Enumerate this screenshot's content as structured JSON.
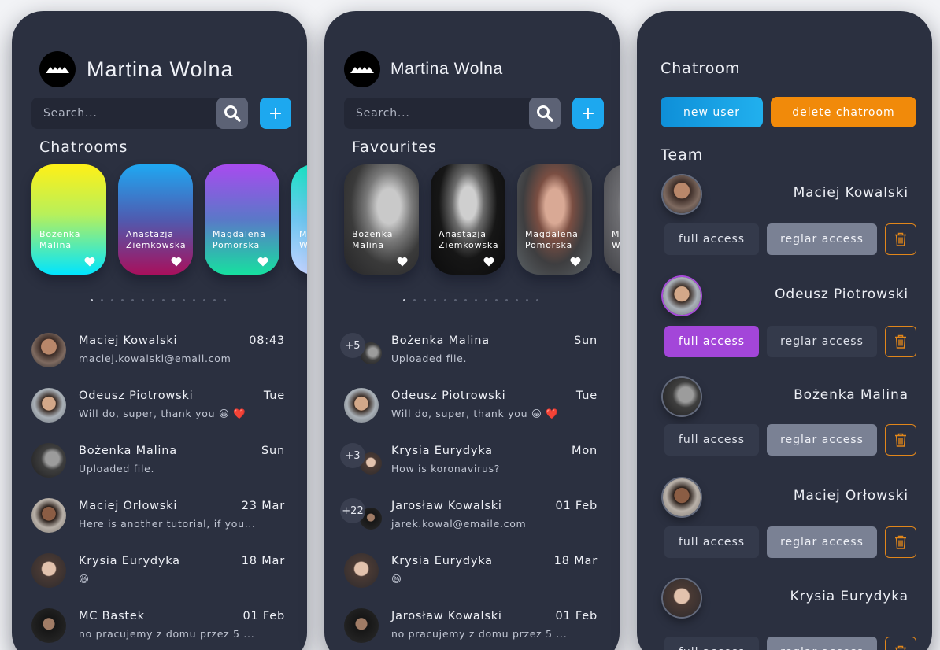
{
  "user": {
    "name": "Martina Wolna"
  },
  "search": {
    "placeholder": "Search..."
  },
  "add_label": "+",
  "panel1": {
    "section": "Chatrooms",
    "cards": [
      {
        "line1": "Bożenka",
        "line2": "Malina"
      },
      {
        "line1": "Anastazja",
        "line2": "Ziemkowska"
      },
      {
        "line1": "Magdalena",
        "line2": "Pomorska"
      },
      {
        "line1": "M",
        "line2": "W"
      }
    ],
    "chats": [
      {
        "name": "Maciej Kowalski",
        "time": "08:43",
        "msg": "maciej.kowalski@email.com"
      },
      {
        "name": "Odeusz Piotrowski",
        "time": "Tue",
        "msg": "Will do, super, thank you 😀 ❤️"
      },
      {
        "name": "Bożenka Malina",
        "time": "Sun",
        "msg": "Uploaded file."
      },
      {
        "name": "Maciej Orłowski",
        "time": "23 Mar",
        "msg": "Here is another tutorial, if you..."
      },
      {
        "name": "Krysia Eurydyka",
        "time": "18 Mar",
        "msg": "😆"
      },
      {
        "name": "MC Bastek",
        "time": "01 Feb",
        "msg": "no pracujemy z domu przez 5 ..."
      }
    ]
  },
  "panel2": {
    "section": "Favourites",
    "cards": [
      {
        "line1": "Bożenka",
        "line2": "Malina"
      },
      {
        "line1": "Anastazja",
        "line2": "Ziemkowska"
      },
      {
        "line1": "Magdalena",
        "line2": "Pomorska"
      },
      {
        "line1": "M",
        "line2": "W"
      }
    ],
    "chats": [
      {
        "badge": "+5",
        "name": "Bożenka Malina",
        "time": "Sun",
        "msg": "Uploaded file."
      },
      {
        "badge": "",
        "name": "Odeusz Piotrowski",
        "time": "Tue",
        "msg": "Will do, super, thank you 😀 ❤️"
      },
      {
        "badge": "+3",
        "name": "Krysia Eurydyka",
        "time": "Mon",
        "msg": "How is koronavirus?"
      },
      {
        "badge": "+22",
        "name": "Jarosław Kowalski",
        "time": "01 Feb",
        "msg": "jarek.kowal@emaile.com"
      },
      {
        "badge": "",
        "name": "Krysia Eurydyka",
        "time": "18 Mar",
        "msg": "😆"
      },
      {
        "badge": "",
        "name": "Jarosław Kowalski",
        "time": "01 Feb",
        "msg": "no pracujemy z domu przez 5 ..."
      }
    ]
  },
  "panel3": {
    "title": "Chatroom",
    "new_user": "new user",
    "delete_chatroom": "delete chatroom",
    "team_label": "Team",
    "full_access": "full access",
    "reglar_access": "reglar access",
    "members": [
      {
        "name": "Maciej Kowalski"
      },
      {
        "name": "Odeusz Piotrowski"
      },
      {
        "name": "Bożenka Malina"
      },
      {
        "name": "Maciej Orłowski"
      },
      {
        "name": "Krysia Eurydyka"
      }
    ]
  },
  "colors": {
    "panel_bg": "#2b3040",
    "accent_blue": "#1da8ef",
    "accent_orange": "#f18a0a",
    "accent_purple": "#a346d9"
  }
}
